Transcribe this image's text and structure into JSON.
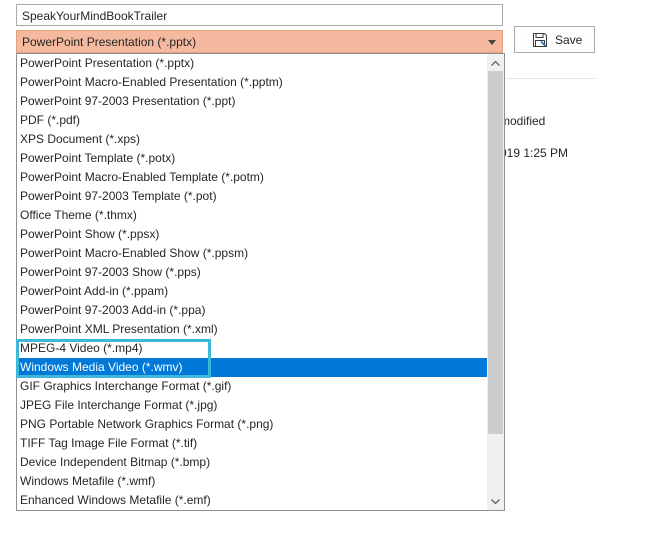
{
  "filename": {
    "value": "SpeakYourMindBookTrailer"
  },
  "filetype": {
    "selected": "PowerPoint Presentation (*.pptx)"
  },
  "save_button": {
    "label": "Save",
    "icon": "save-icon"
  },
  "background": {
    "modified_label": "modified",
    "date_text": "019 1:25 PM"
  },
  "dropdown": {
    "items": [
      "PowerPoint Presentation (*.pptx)",
      "PowerPoint Macro-Enabled Presentation (*.pptm)",
      "PowerPoint 97-2003 Presentation (*.ppt)",
      "PDF (*.pdf)",
      "XPS Document (*.xps)",
      "PowerPoint Template (*.potx)",
      "PowerPoint Macro-Enabled Template (*.potm)",
      "PowerPoint 97-2003 Template (*.pot)",
      "Office Theme (*.thmx)",
      "PowerPoint Show (*.ppsx)",
      "PowerPoint Macro-Enabled Show (*.ppsm)",
      "PowerPoint 97-2003 Show (*.pps)",
      "PowerPoint Add-in (*.ppam)",
      "PowerPoint 97-2003 Add-in (*.ppa)",
      "PowerPoint XML Presentation (*.xml)",
      "MPEG-4 Video (*.mp4)",
      "Windows Media Video (*.wmv)",
      "GIF Graphics Interchange Format (*.gif)",
      "JPEG File Interchange Format (*.jpg)",
      "PNG Portable Network Graphics Format (*.png)",
      "TIFF Tag Image File Format (*.tif)",
      "Device Independent Bitmap (*.bmp)",
      "Windows Metafile (*.wmf)",
      "Enhanced Windows Metafile (*.emf)"
    ],
    "selected_index": 16,
    "highlighted_items": [
      "MPEG-4 Video (*.mp4)",
      "Windows Media Video (*.wmv)"
    ]
  },
  "colors": {
    "selection": "#0078d7",
    "combobox_fill": "#f5b9a0",
    "highlight_box": "#3db8d8"
  }
}
